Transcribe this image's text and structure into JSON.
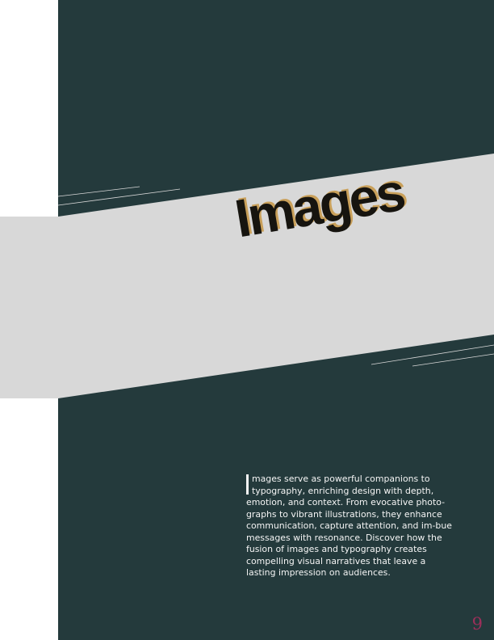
{
  "page": {
    "title": "Images",
    "body_text": "mages serve as powerful companions to typography, enriching design with depth, emotion, and context. From evocative photo-graphs to vibrant illustrations, they enhance communication, capture attention, and im-bue messages with resonance. Discover how the fusion of images and typography creates compelling visual narratives that leave a lasting impression on audiences.",
    "drop_cap": "I",
    "page_number": "9"
  },
  "colors": {
    "panel": "#243a3c",
    "band": "#d8d8d8",
    "title": "#16140f",
    "title_shadow": "#c9a05a",
    "body_text": "#f4f4f4",
    "page_number": "#9c2f5a"
  }
}
